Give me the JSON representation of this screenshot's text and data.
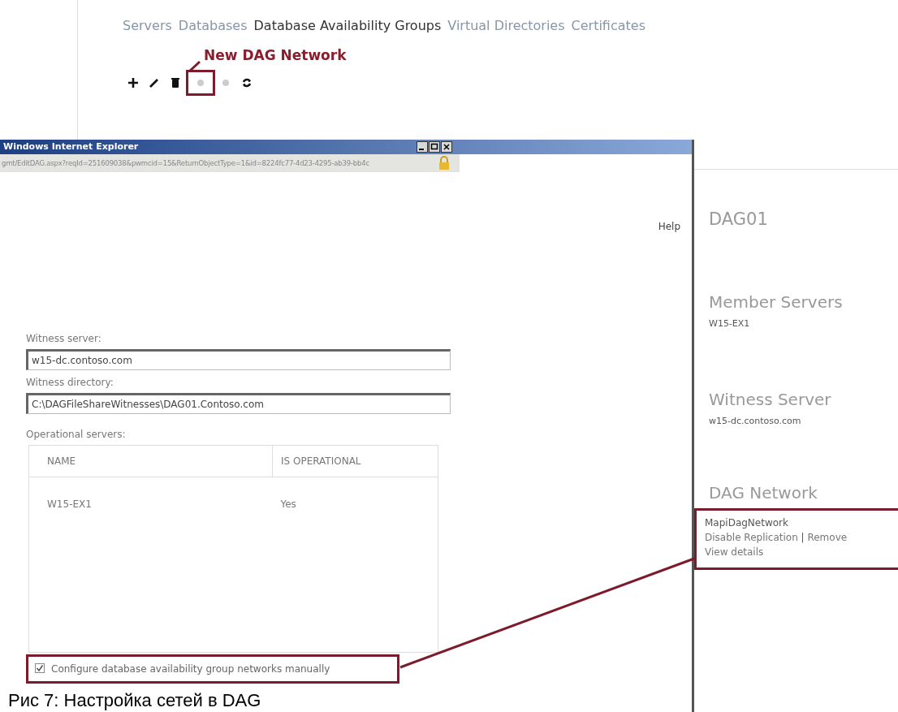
{
  "tabs": [
    {
      "label": "Servers",
      "selected": false
    },
    {
      "label": "Databases",
      "selected": false
    },
    {
      "label": "Database Availability Groups",
      "selected": true
    },
    {
      "label": "Virtual Directories",
      "selected": false
    },
    {
      "label": "Certificates",
      "selected": false
    }
  ],
  "annotation": {
    "text": "New DAG Network"
  },
  "toolbar": [
    {
      "kind": "add"
    },
    {
      "kind": "edit"
    },
    {
      "kind": "delete"
    },
    {
      "kind": "dot",
      "annotated": true
    },
    {
      "kind": "dot"
    },
    {
      "kind": "refresh"
    }
  ],
  "dialog": {
    "title": "Windows Internet Explorer",
    "address": "gmt/EditDAG.aspx?reqId=251609038&pwmcid=15&ReturnObjectType=1&id=8224fc77-4d23-4295-ab39-bb4c",
    "help": "Help",
    "fields": [
      {
        "label": "Witness server:",
        "value": "w15-dc.contoso.com"
      },
      {
        "label": "Witness directory:",
        "value": "C:\\DAGFileShareWitnesses\\DAG01.Contoso.com"
      }
    ],
    "table": {
      "label": "Operational servers:",
      "columns": [
        "NAME",
        "IS OPERATIONAL"
      ],
      "rows": [
        [
          "W15-EX1",
          "Yes"
        ]
      ]
    },
    "checkbox": {
      "label": "Configure database availability group networks manually",
      "checked": true,
      "annotated": true
    }
  },
  "details": {
    "title": "DAG01",
    "sections": [
      {
        "heading": "Member Servers",
        "value": "W15-EX1"
      },
      {
        "heading": "Witness Server",
        "value": "w15-dc.contoso.com"
      }
    ],
    "network": {
      "heading": "DAG Network",
      "name": "MapiDagNetwork",
      "actions": [
        "Disable Replication",
        "Remove"
      ],
      "separator": "|",
      "details_link": "View details",
      "annotated": true
    }
  },
  "caption": "Рис 7: Настройка сетей в DAG"
}
